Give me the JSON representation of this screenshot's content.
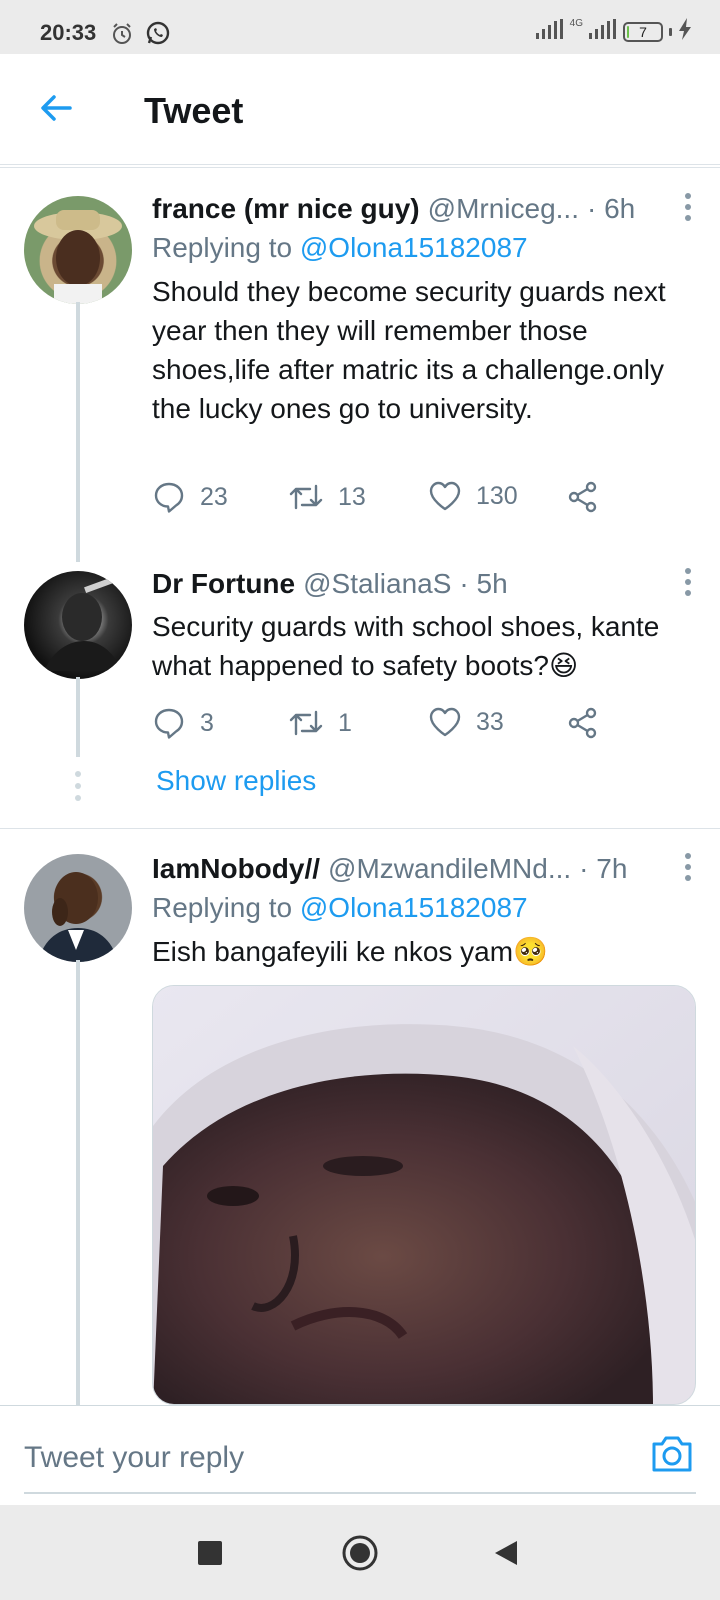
{
  "status_bar": {
    "time": "20:33",
    "network_label": "4G",
    "battery_level": "7",
    "battery_percent": 7
  },
  "header": {
    "title": "Tweet"
  },
  "tweets": [
    {
      "name": "france (mr nice guy)",
      "handle": "@Mrniceg...",
      "time": "· 6h",
      "replying_label": "Replying to",
      "replying_to": "@Olona15182087",
      "text": "Should they become security guards next year then they will remember those shoes,life after matric its a challenge.only the lucky ones go to university.",
      "replies": "23",
      "retweets": "13",
      "likes": "130"
    },
    {
      "name": "Dr Fortune",
      "handle": "@StalianaS",
      "time": "· 5h",
      "text": "Security guards with school shoes, kante what happened to safety boots?😆",
      "replies": "3",
      "retweets": "1",
      "likes": "33",
      "show_replies": "Show replies"
    },
    {
      "name": "IamNobody//",
      "handle": "@MzwandileMNd...",
      "time": "· 7h",
      "replying_label": "Replying to",
      "replying_to": "@Olona15182087",
      "text": "Eish bangafeyili ke nkos yam🥺"
    }
  ],
  "reply_bar": {
    "placeholder": "Tweet your reply"
  },
  "colors": {
    "accent": "#1d9bf0",
    "secondary_text": "#657786",
    "thread_line": "#cfd9de"
  },
  "icons": [
    "back-arrow-icon",
    "alarm-icon",
    "whatsapp-icon",
    "signal-icon",
    "battery-icon",
    "charging-icon",
    "more-vertical-icon",
    "reply-icon",
    "retweet-icon",
    "like-icon",
    "share-icon",
    "camera-icon",
    "recents-icon",
    "home-icon",
    "back-icon"
  ]
}
